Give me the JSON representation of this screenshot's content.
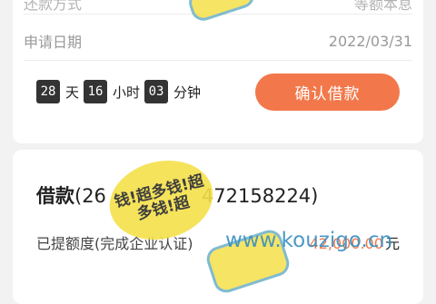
{
  "repay_row": {
    "label": "还款方式",
    "value": "等额本息"
  },
  "apply_row": {
    "label": "申请日期",
    "value": "2022/03/31"
  },
  "countdown": {
    "days": "28",
    "days_unit": "天",
    "hours": "16",
    "hours_unit": "小时",
    "minutes": "03",
    "minutes_unit": "分钟"
  },
  "confirm_button": {
    "label": "确认借款"
  },
  "loan": {
    "title_prefix": "借款",
    "title_number": "(26",
    "title_suffix": "472158224)",
    "extracted_label": "已提额度(完成企业认证)",
    "extracted_value": "42,000.00",
    "extracted_unit": "元"
  },
  "stamp_text": "钱!超多钱!超多钱!超",
  "watermark": "www.kouzigo.cn",
  "colors": {
    "accent": "#f2784b",
    "countdown_box": "#333333",
    "stamp": "#f5e04a"
  }
}
